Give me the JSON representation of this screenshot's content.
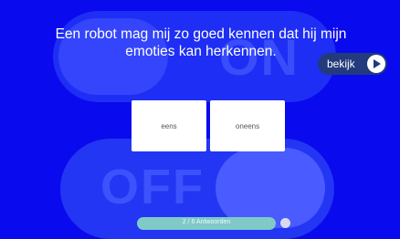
{
  "question": {
    "line1": "Een robot mag mij zo goed kennen dat hij mijn",
    "line2": "emoties kan herkennen."
  },
  "background": {
    "on_label": "ON",
    "off_label": "OFF"
  },
  "watch_button": {
    "label": "bekijk"
  },
  "options": [
    {
      "label": "eens"
    },
    {
      "label": "oneens"
    }
  ],
  "progress": {
    "label": "2 / 6 Antwoorden"
  }
}
